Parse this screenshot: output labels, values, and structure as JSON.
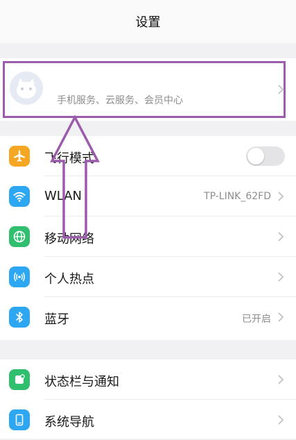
{
  "header": {
    "title": "设置"
  },
  "account": {
    "name": "",
    "subtitle": "手机服务、云服务、会员中心",
    "highlight_color": "#9b5cab"
  },
  "groups": [
    {
      "rows": [
        {
          "label": "飞行模式",
          "icon": "airplane-icon",
          "icon_color": "#f5a623",
          "control": "toggle",
          "toggle_on": false
        },
        {
          "label": "WLAN",
          "icon": "wifi-icon",
          "icon_color": "#2ea7f2",
          "value": "TP-LINK_62FD"
        },
        {
          "label": "移动网络",
          "icon": "globe-icon",
          "icon_color": "#2fbf6f"
        },
        {
          "label": "个人热点",
          "icon": "hotspot-icon",
          "icon_color": "#2ea7f2"
        },
        {
          "label": "蓝牙",
          "icon": "bluetooth-icon",
          "icon_color": "#2ea7f2",
          "value": "已开启"
        }
      ]
    },
    {
      "rows": [
        {
          "label": "状态栏与通知",
          "icon": "status-bar-icon",
          "icon_color": "#2fbf6f"
        },
        {
          "label": "系统导航",
          "icon": "navigation-icon",
          "icon_color": "#2ea7f2"
        }
      ]
    }
  ],
  "colors": {
    "background": "#f1f1f3",
    "card": "#ffffff",
    "annotation": "#9b5cab"
  }
}
